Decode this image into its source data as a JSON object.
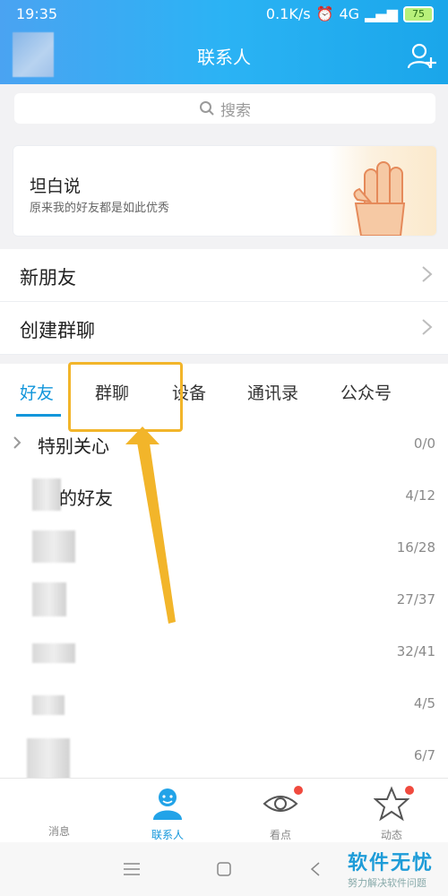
{
  "status": {
    "time": "19:35",
    "speed": "0.1K/s",
    "network": "4G",
    "battery": "75"
  },
  "header": {
    "title": "联系人"
  },
  "search": {
    "placeholder": "搜索"
  },
  "banner": {
    "title": "坦白说",
    "subtitle": "原来我的好友都是如此优秀"
  },
  "rows": [
    {
      "label": "新朋友"
    },
    {
      "label": "创建群聊"
    }
  ],
  "tabs": [
    {
      "label": "好友"
    },
    {
      "label": "群聊"
    },
    {
      "label": "设备"
    },
    {
      "label": "通讯录"
    },
    {
      "label": "公众号"
    }
  ],
  "groups": [
    {
      "name": "特别关心",
      "count": "0/0"
    },
    {
      "name": "的好友",
      "count": "4/12"
    },
    {
      "name": "",
      "count": "16/28"
    },
    {
      "name": "",
      "count": "27/37"
    },
    {
      "name": "",
      "count": "32/41"
    },
    {
      "name": "",
      "count": "4/5"
    },
    {
      "name": "",
      "count": "6/7"
    }
  ],
  "tabbar": {
    "messages": "消息",
    "contacts": "联系人",
    "kandian": "看点",
    "dongtai": "动态"
  },
  "watermark": {
    "line1": "软件无忧",
    "line2": "努力解决软件问题"
  },
  "colors": {
    "accent": "#1296db",
    "highlight": "#f2b52a",
    "badge": "#f04a3e"
  }
}
